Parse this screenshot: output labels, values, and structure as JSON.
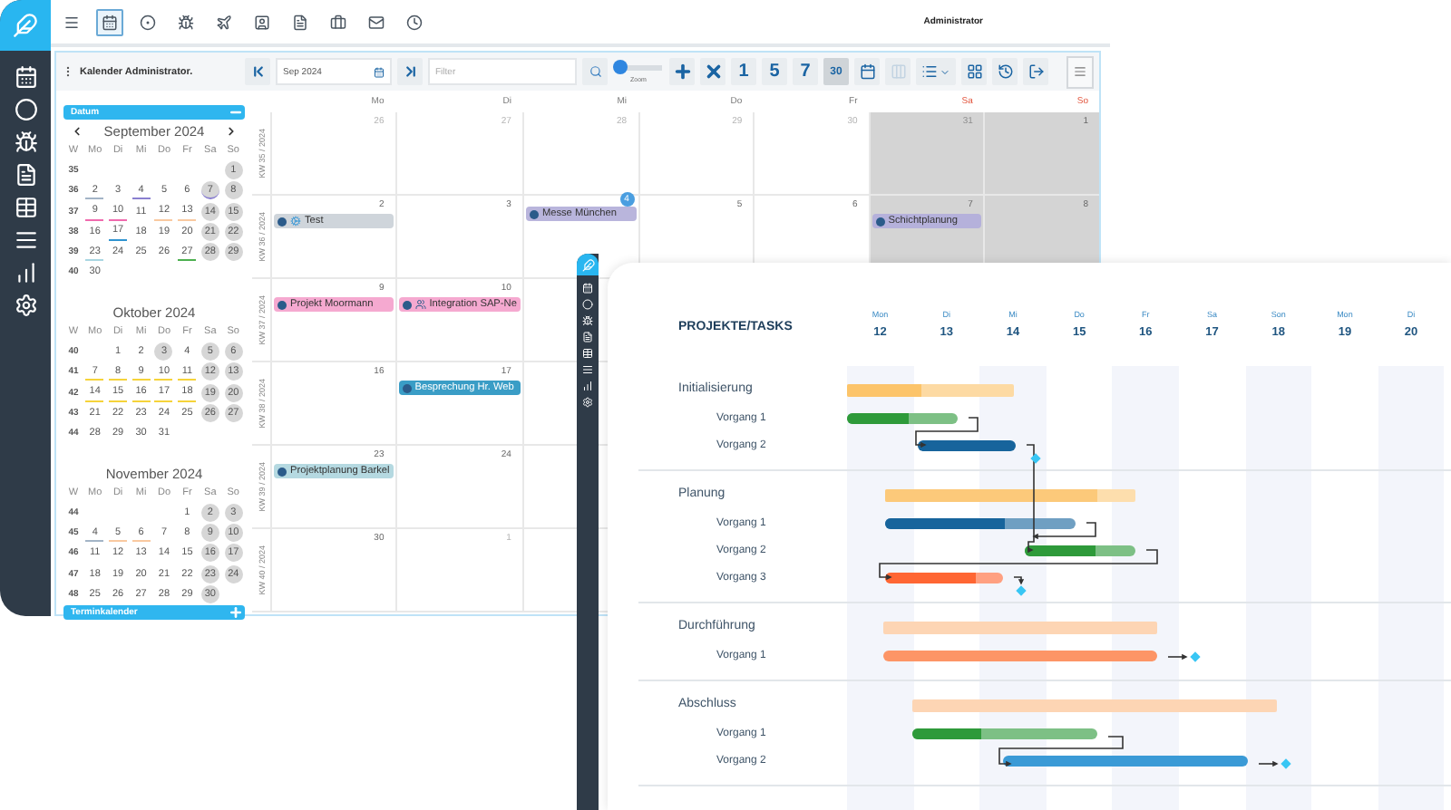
{
  "top_bar": {
    "tools": [
      {
        "selected": false
      },
      {
        "selected": true
      },
      {
        "selected": false
      },
      {
        "selected": false
      },
      {
        "selected": false
      },
      {
        "selected": false
      },
      {
        "selected": false
      },
      {
        "selected": false
      },
      {
        "selected": false
      },
      {
        "selected": false
      }
    ],
    "user": "Administrator"
  },
  "calendar_toolbar": {
    "title": "Kalender Administrator.",
    "date": "Sep 2024",
    "filter_placeholder": "Filter",
    "zoom": {
      "label": "Zoom",
      "level": 0.1
    },
    "view_buttons": [
      {
        "label": "1",
        "selected": false
      },
      {
        "label": "5",
        "selected": false
      },
      {
        "label": "7",
        "selected": false
      },
      {
        "label": "30",
        "selected": true
      }
    ],
    "tools": [
      {
        "disabled": false
      },
      {
        "disabled": true
      },
      {
        "disabled": false
      },
      {
        "disabled": false
      },
      {
        "disabled": false
      },
      {
        "disabled": false
      }
    ]
  },
  "mini_calendar": {
    "header": "Datum",
    "footer": "Terminkalender",
    "months": [
      {
        "title": "September 2024",
        "weekdays": [
          "W",
          "Mo",
          "Di",
          "Mi",
          "Do",
          "Fr",
          "Sa",
          "So"
        ],
        "weeks": [
          {
            "kw": "35",
            "days": [
              "1"
            ]
          },
          {
            "kw": "36",
            "days": [
              {
                "d": "2",
                "color": "#a3b4c6"
              },
              "3",
              {
                "d": "4",
                "color": "#8a7fd0"
              },
              "5",
              "6",
              {
                "d": "7",
                "color": "#8a7fd0"
              },
              "8"
            ]
          },
          {
            "kw": "37",
            "days": [
              {
                "d": "9",
                "color": "#f06aae"
              },
              {
                "d": "10",
                "color": "#f06aae"
              },
              "11",
              {
                "d": "12",
                "color": "#f9c9a0"
              },
              {
                "d": "13",
                "color": "#f9c9a0"
              },
              "14",
              "15"
            ]
          },
          {
            "kw": "38",
            "days": [
              "16",
              {
                "d": "17",
                "color": "#2f94d0"
              },
              "18",
              "19",
              "20",
              "21",
              "22"
            ]
          },
          {
            "kw": "39",
            "days": [
              {
                "d": "23",
                "color": "#a9d6e2"
              },
              "24",
              "25",
              "26",
              {
                "d": "27",
                "color": "#4cb050"
              },
              "28",
              "29"
            ]
          },
          {
            "kw": "40",
            "days": [
              "30"
            ]
          }
        ]
      },
      {
        "title": "Oktober 2024",
        "weekdays": [
          "W",
          "Mo",
          "Di",
          "Mi",
          "Do",
          "Fr",
          "Sa",
          "So"
        ],
        "weeks": [
          {
            "kw": "40",
            "days": [
              "1",
              "2",
              {
                "d": "3",
                "holiday": true
              },
              "4",
              "5",
              "6"
            ]
          },
          {
            "kw": "41",
            "days": [
              {
                "d": "7",
                "color": "#f5d33a"
              },
              {
                "d": "8",
                "color": "#f5d33a"
              },
              {
                "d": "9",
                "color": "#f5d33a"
              },
              {
                "d": "10",
                "color": "#f5d33a"
              },
              {
                "d": "11",
                "color": "#f5d33a"
              },
              "12",
              "13"
            ]
          },
          {
            "kw": "42",
            "days": [
              {
                "d": "14",
                "color": "#f5d33a"
              },
              {
                "d": "15",
                "color": "#f5d33a"
              },
              {
                "d": "16",
                "color": "#f5d33a"
              },
              {
                "d": "17",
                "color": "#f5d33a"
              },
              {
                "d": "18",
                "color": "#f5d33a"
              },
              "19",
              "20"
            ]
          },
          {
            "kw": "43",
            "days": [
              "21",
              "22",
              "23",
              "24",
              "25",
              "26",
              "27"
            ]
          },
          {
            "kw": "44",
            "days": [
              "28",
              "29",
              "30",
              "31"
            ]
          }
        ]
      },
      {
        "title": "November 2024",
        "weekdays": [
          "W",
          "Mo",
          "Di",
          "Mi",
          "Do",
          "Fr",
          "Sa",
          "So"
        ],
        "weeks": [
          {
            "kw": "44",
            "days": [
              "1",
              "2",
              "3"
            ]
          },
          {
            "kw": "45",
            "days": [
              {
                "d": "4",
                "color": "#a3b4c6"
              },
              {
                "d": "5",
                "color": "#f9c9a0"
              },
              {
                "d": "6",
                "color": "#f9c9a0"
              },
              "7",
              "8",
              "9",
              "10"
            ]
          },
          {
            "kw": "46",
            "days": [
              "11",
              "12",
              "13",
              "14",
              "15",
              "16",
              "17"
            ]
          },
          {
            "kw": "47",
            "days": [
              "18",
              "19",
              "20",
              "21",
              "22",
              "23",
              "24"
            ]
          },
          {
            "kw": "48",
            "days": [
              "25",
              "26",
              "27",
              "28",
              "29",
              "30"
            ]
          }
        ]
      }
    ]
  },
  "calendar": {
    "columns": [
      {
        "label": "Mo",
        "weekend": false
      },
      {
        "label": "Di",
        "weekend": false
      },
      {
        "label": "Mi",
        "weekend": false
      },
      {
        "label": "Do",
        "weekend": false
      },
      {
        "label": "Fr",
        "weekend": false
      },
      {
        "label": "Sa",
        "weekend": true
      },
      {
        "label": "So",
        "weekend": true
      }
    ],
    "weeks": [
      {
        "label": "KW 35 / 2024",
        "days": [
          {
            "day": "26",
            "muted": true
          },
          {
            "day": "27",
            "muted": true
          },
          {
            "day": "28",
            "muted": true
          },
          {
            "day": "29",
            "muted": true
          },
          {
            "day": "30",
            "muted": true
          },
          {
            "day": "31",
            "muted": true
          },
          {
            "day": "1",
            "muted": false
          }
        ]
      },
      {
        "label": "KW 36 / 2024",
        "days": [
          {
            "day": "2",
            "muted": false,
            "events": [
              {
                "title": "Test",
                "kind": "gear",
                "color": "#cfd5db"
              }
            ]
          },
          {
            "day": "3",
            "muted": false
          },
          {
            "day": "4",
            "muted": false,
            "today": true,
            "events": [
              {
                "title": "Messe München",
                "kind": "plain",
                "color": "#b9b5dc"
              }
            ]
          },
          {
            "day": "5",
            "muted": false
          },
          {
            "day": "6",
            "muted": false
          },
          {
            "day": "7",
            "muted": false,
            "events": [
              {
                "title": "Schichtplanung",
                "kind": "plain",
                "color": "#b5b1db"
              }
            ]
          },
          {
            "day": "8",
            "muted": false
          }
        ]
      },
      {
        "label": "KW 37 / 2024",
        "days": [
          {
            "day": "9",
            "muted": false,
            "events": [
              {
                "title": "Projekt Moormann",
                "kind": "plain",
                "color": "#f5a9d0"
              }
            ]
          },
          {
            "day": "10",
            "muted": false,
            "events": [
              {
                "title": "Integration SAP-Ne",
                "kind": "group",
                "color": "#f5a9d0"
              }
            ]
          }
        ]
      },
      {
        "label": "KW 38 / 2024",
        "days": [
          {
            "day": "16",
            "muted": false
          },
          {
            "day": "17",
            "muted": false,
            "events": [
              {
                "title": "Besprechung Hr. Web",
                "kind": "plain",
                "color": "#3a9dc6"
              }
            ]
          }
        ]
      },
      {
        "label": "KW 39 / 2024",
        "days": [
          {
            "day": "23",
            "muted": false,
            "events": [
              {
                "title": "Projektplanung Barkel",
                "kind": "plain",
                "color": "#b5d9e1"
              }
            ]
          },
          {
            "day": "24",
            "muted": false
          }
        ]
      },
      {
        "label": "KW 40 / 2024",
        "days": [
          {
            "day": "30",
            "muted": false
          },
          {
            "day": "1",
            "muted": true
          }
        ]
      }
    ]
  },
  "gantt": {
    "title": "PROJEKTE/TASKS",
    "days": [
      {
        "name": "Mon",
        "date": "12"
      },
      {
        "name": "Di",
        "date": "13"
      },
      {
        "name": "Mi",
        "date": "14"
      },
      {
        "name": "Do",
        "date": "15"
      },
      {
        "name": "Fr",
        "date": "16"
      },
      {
        "name": "Sa",
        "date": "17"
      },
      {
        "name": "Son",
        "date": "18"
      },
      {
        "name": "Mon",
        "date": "19"
      },
      {
        "name": "Di",
        "date": "20"
      }
    ],
    "groups": [
      {
        "name": "Initialisierung",
        "color": "#fcc46a",
        "level": 0.45,
        "tasks": [
          {
            "name": "Vorgang 1",
            "color": "#2e9a3a",
            "level": 0.55,
            "milestone": false
          },
          {
            "name": "Vorgang 2",
            "color": "#17649c",
            "level": 1,
            "milestone": true
          }
        ]
      },
      {
        "name": "Planung",
        "color": "#fcc97a",
        "level": 0.85,
        "tasks": [
          {
            "name": "Vorgang 1",
            "color": "#17649c",
            "level": 0.63,
            "milestone": false
          },
          {
            "name": "Vorgang 2",
            "color": "#2e9a3a",
            "level": 0.64,
            "milestone": false
          },
          {
            "name": "Vorgang 3",
            "color": "#ff6633",
            "level": 0.77,
            "milestone": true
          }
        ]
      },
      {
        "name": "Durchführung",
        "color": "#fdd5b4",
        "level": 1,
        "tasks": [
          {
            "name": "Vorgang 1",
            "color": "#fd9566",
            "level": 1,
            "milestone": true
          }
        ]
      },
      {
        "name": "Abschluss",
        "color": "#fdd5b4",
        "level": 1,
        "tasks": [
          {
            "name": "Vorgang 1",
            "color": "#2e9a3a",
            "level": 0.37,
            "milestone": false
          },
          {
            "name": "Vorgang 2",
            "color": "#3a9ad6",
            "level": 1,
            "milestone": true
          }
        ]
      }
    ]
  }
}
